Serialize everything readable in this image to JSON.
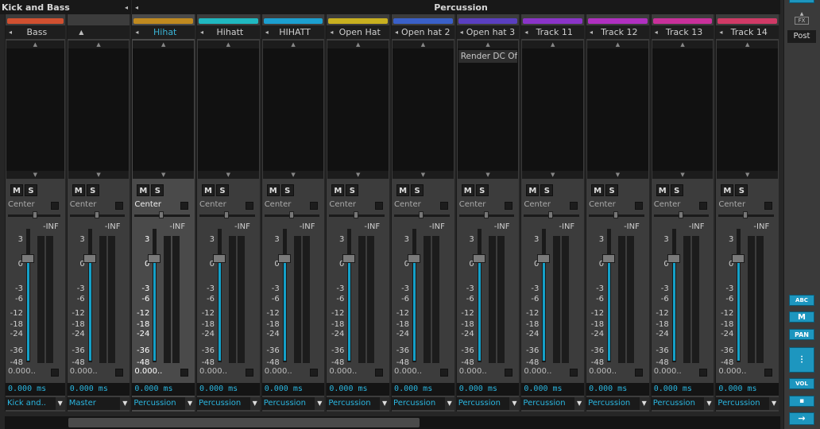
{
  "groups": [
    {
      "name": "Kick and Bass",
      "arrow": "◂"
    },
    {
      "name": "Percussion",
      "arrow": "◂"
    }
  ],
  "scale_ticks": [
    "3",
    "0",
    "-3",
    "-6",
    "-12",
    "-18",
    "-24",
    "-36",
    "-48"
  ],
  "meter_top_label": "-INF",
  "pan_label": "Center",
  "mute_label": "M",
  "solo_label": "S",
  "volume_value": "0.000..",
  "delay_value": "0.000 ms",
  "strips": [
    {
      "name": "Bass",
      "color": "#d05030",
      "route": "Kick and..",
      "fx": []
    },
    {
      "name": "",
      "color": "",
      "route": "Master",
      "fx": []
    },
    {
      "name": "Hihat",
      "color": "#c08a20",
      "route": "Percussion",
      "fx": [],
      "selected": true
    },
    {
      "name": "Hihatt",
      "color": "#20b8c0",
      "route": "Percussion",
      "fx": []
    },
    {
      "name": "HIHATT",
      "color": "#1c9fd0",
      "route": "Percussion",
      "fx": []
    },
    {
      "name": "Open Hat",
      "color": "#c8b020",
      "route": "Percussion",
      "fx": []
    },
    {
      "name": "Open hat 2",
      "color": "#3a60c8",
      "route": "Percussion",
      "fx": []
    },
    {
      "name": "Open hat 3",
      "color": "#5a3fc0",
      "route": "Percussion",
      "fx": [
        "Render DC Of.."
      ]
    },
    {
      "name": "Track 11",
      "color": "#8a34c8",
      "route": "Percussion",
      "fx": []
    },
    {
      "name": "Track 12",
      "color": "#b030c0",
      "route": "Percussion",
      "fx": []
    },
    {
      "name": "Track 13",
      "color": "#c8309a",
      "route": "Percussion",
      "fx": []
    },
    {
      "name": "Track 14",
      "color": "#d03a66",
      "route": "Percussion",
      "fx": []
    }
  ],
  "right_panel": {
    "fx_label": "FX",
    "post_label": "Post",
    "buttons": [
      "ABC",
      "M",
      "PAN",
      "",
      "VOL",
      "",
      "→"
    ]
  }
}
